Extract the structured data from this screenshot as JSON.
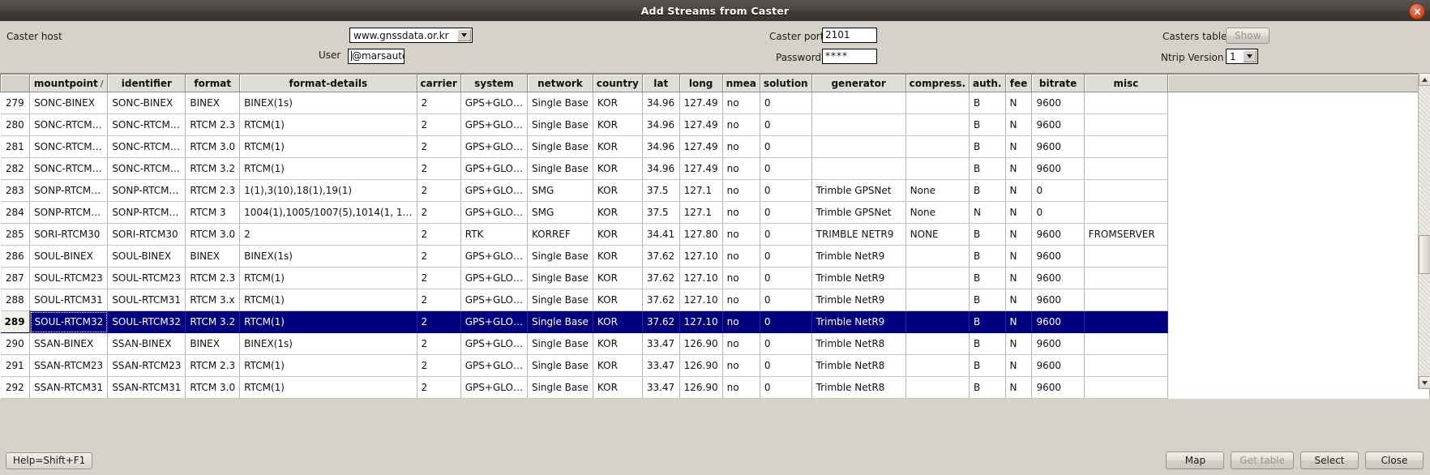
{
  "window": {
    "title": "Add Streams from Caster",
    "close_icon": "close-icon"
  },
  "form": {
    "caster_host_label": "Caster host",
    "caster_host_value": "www.gnssdata.or.kr",
    "user_label": "User",
    "user_value": "@marsauto.io",
    "caster_port_label": "Caster port",
    "caster_port_value": "2101",
    "password_label": "Password",
    "password_value": "****",
    "casters_table_label": "Casters table",
    "show_button": "Show",
    "ntrip_version_label": "Ntrip Version",
    "ntrip_version_value": "1"
  },
  "table": {
    "columns": [
      "mountpoint",
      "identifier",
      "format",
      "format-details",
      "carrier",
      "system",
      "network",
      "country",
      "lat",
      "long",
      "nmea",
      "solution",
      "generator",
      "compress.",
      "auth.",
      "fee",
      "bitrate",
      "misc"
    ],
    "sort_indicator": "/",
    "selected_row_index": 10,
    "rows": [
      {
        "n": "279",
        "cells": [
          "SONC-BINEX",
          "SONC-BINEX",
          "BINEX",
          "BINEX(1s)",
          "2",
          "GPS+GLO…",
          "Single Base",
          "KOR",
          "34.96",
          "127.49",
          "no",
          "0",
          "",
          "",
          "B",
          "N",
          "9600",
          ""
        ]
      },
      {
        "n": "280",
        "cells": [
          "SONC-RTCM…",
          "SONC-RTCM…",
          "RTCM 2.3",
          "RTCM(1)",
          "2",
          "GPS+GLO…",
          "Single Base",
          "KOR",
          "34.96",
          "127.49",
          "no",
          "0",
          "",
          "",
          "B",
          "N",
          "9600",
          ""
        ]
      },
      {
        "n": "281",
        "cells": [
          "SONC-RTCM…",
          "SONC-RTCM…",
          "RTCM 3.0",
          "RTCM(1)",
          "2",
          "GPS+GLO…",
          "Single Base",
          "KOR",
          "34.96",
          "127.49",
          "no",
          "0",
          "",
          "",
          "B",
          "N",
          "9600",
          ""
        ]
      },
      {
        "n": "282",
        "cells": [
          "SONC-RTCM…",
          "SONC-RTCM…",
          "RTCM 3.2",
          "RTCM(1)",
          "2",
          "GPS+GLO…",
          "Single Base",
          "KOR",
          "34.96",
          "127.49",
          "no",
          "0",
          "",
          "",
          "B",
          "N",
          "9600",
          ""
        ]
      },
      {
        "n": "283",
        "cells": [
          "SONP-RTCM…",
          "SONP-RTCM…",
          "RTCM 2.3",
          "1(1),3(10),18(1),19(1)",
          "2",
          "GPS+GLO…",
          "SMG",
          "KOR",
          "37.5",
          "127.1",
          "no",
          "0",
          "Trimble GPSNet",
          "None",
          "B",
          "N",
          "0",
          ""
        ]
      },
      {
        "n": "284",
        "cells": [
          "SONP-RTCM…",
          "SONP-RTCM…",
          "RTCM 3",
          "1004(1),1005/1007(5),1014(1, 1…",
          "2",
          "GPS+GLO…",
          "SMG",
          "KOR",
          "37.5",
          "127.1",
          "no",
          "0",
          "Trimble GPSNet",
          "None",
          "N",
          "N",
          "0",
          ""
        ]
      },
      {
        "n": "285",
        "cells": [
          "SORI-RTCM30",
          "SORI-RTCM30",
          "RTCM 3.0",
          "2",
          "2",
          "RTK",
          "KORREF",
          "KOR",
          "34.41",
          "127.80",
          "no",
          "0",
          "TRIMBLE NETR9",
          "NONE",
          "B",
          "N",
          "9600",
          "FROMSERVER"
        ]
      },
      {
        "n": "286",
        "cells": [
          "SOUL-BINEX",
          "SOUL-BINEX",
          "BINEX",
          "BINEX(1s)",
          "2",
          "GPS+GLO…",
          "Single Base",
          "KOR",
          "37.62",
          "127.10",
          "no",
          "0",
          "Trimble NetR9",
          "",
          "B",
          "N",
          "9600",
          ""
        ]
      },
      {
        "n": "287",
        "cells": [
          "SOUL-RTCM23",
          "SOUL-RTCM23",
          "RTCM 2.3",
          "RTCM(1)",
          "2",
          "GPS+GLO…",
          "Single Base",
          "KOR",
          "37.62",
          "127.10",
          "no",
          "0",
          "Trimble NetR9",
          "",
          "B",
          "N",
          "9600",
          ""
        ]
      },
      {
        "n": "288",
        "cells": [
          "SOUL-RTCM31",
          "SOUL-RTCM31",
          "RTCM 3.x",
          "RTCM(1)",
          "2",
          "GPS+GLO…",
          "Single Base",
          "KOR",
          "37.62",
          "127.10",
          "no",
          "0",
          "Trimble NetR9",
          "",
          "B",
          "N",
          "9600",
          ""
        ]
      },
      {
        "n": "289",
        "cells": [
          "SOUL-RTCM32",
          "SOUL-RTCM32",
          "RTCM 3.2",
          "RTCM(1)",
          "2",
          "GPS+GLO…",
          "Single Base",
          "KOR",
          "37.62",
          "127.10",
          "no",
          "0",
          "Trimble NetR9",
          "",
          "B",
          "N",
          "9600",
          ""
        ]
      },
      {
        "n": "290",
        "cells": [
          "SSAN-BINEX",
          "SSAN-BINEX",
          "BINEX",
          "BINEX(1s)",
          "2",
          "GPS+GLO…",
          "Single Base",
          "KOR",
          "33.47",
          "126.90",
          "no",
          "0",
          "Trimble NetR8",
          "",
          "B",
          "N",
          "9600",
          ""
        ]
      },
      {
        "n": "291",
        "cells": [
          "SSAN-RTCM23",
          "SSAN-RTCM23",
          "RTCM 2.3",
          "RTCM(1)",
          "2",
          "GPS+GLO…",
          "Single Base",
          "KOR",
          "33.47",
          "126.90",
          "no",
          "0",
          "Trimble NetR8",
          "",
          "B",
          "N",
          "9600",
          ""
        ]
      },
      {
        "n": "292",
        "cells": [
          "SSAN-RTCM31",
          "SSAN-RTCM31",
          "RTCM 3.0",
          "RTCM(1)",
          "2",
          "GPS+GLO…",
          "Single Base",
          "KOR",
          "33.47",
          "126.90",
          "no",
          "0",
          "Trimble NetR8",
          "",
          "B",
          "N",
          "9600",
          ""
        ]
      }
    ]
  },
  "bottom": {
    "help_label": "Help=Shift+F1",
    "map_button": "Map",
    "get_table_button": "Get table",
    "select_button": "Select",
    "close_button": "Close"
  },
  "colors": {
    "selection": "#000080",
    "titlebar": "#45403b",
    "dialog_bg": "#d6d2ca"
  }
}
